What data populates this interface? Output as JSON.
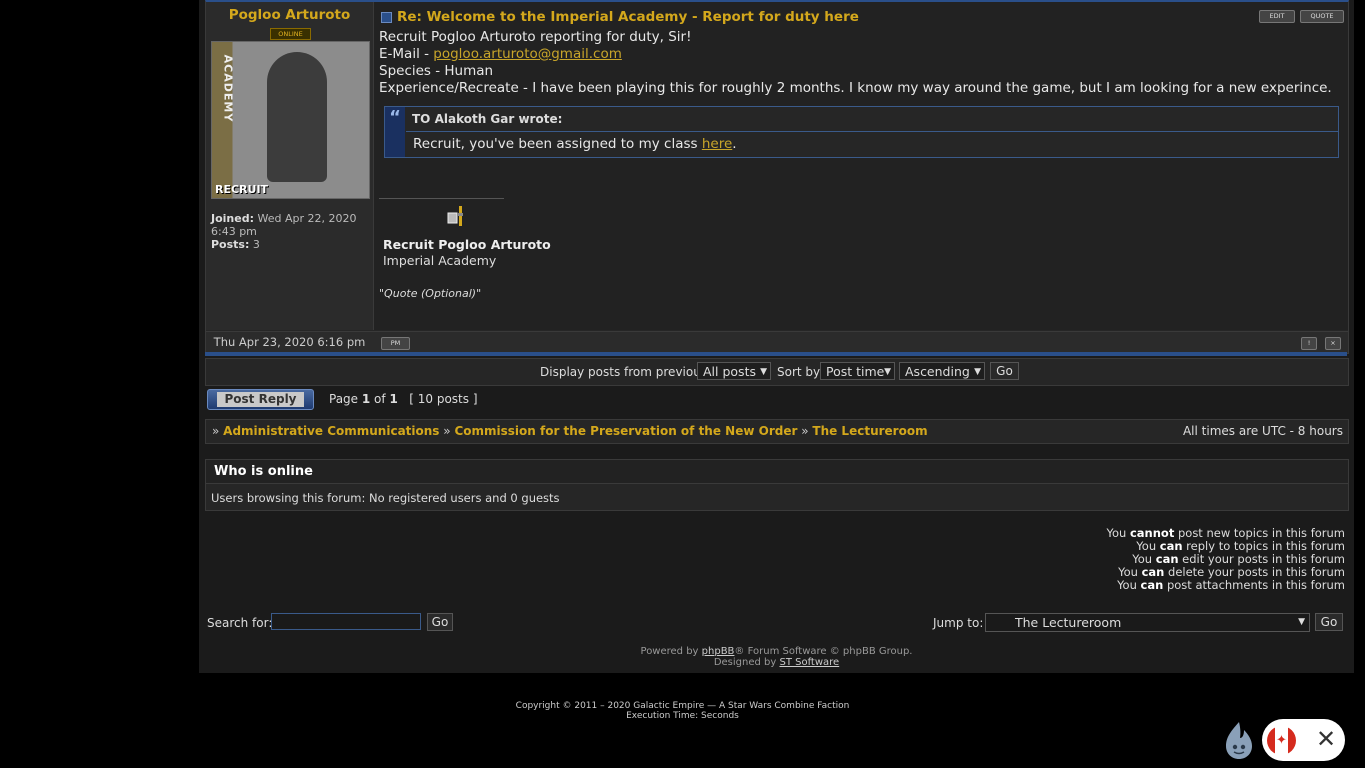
{
  "post": {
    "author": "Pogloo Arturoto",
    "status_badge": "ONLINE",
    "avatar_text_recruit": "RECRUIT",
    "avatar_text_academy": "ACADEMY",
    "joined_label": "Joined:",
    "joined_value": "Wed Apr 22, 2020 6:43 pm",
    "posts_label": "Posts:",
    "posts_value": "3",
    "subject": "Re: Welcome to the Imperial Academy - Report for duty here",
    "edit_label": "EDIT",
    "quote_label": "QUOTE",
    "lines": [
      "Recruit Pogloo Arturoto reporting for duty, Sir!",
      "E-Mail - ",
      "Species - Human",
      "Experience/Recreate - I have been playing this for roughly 2 months. I know my way around the game, but I am looking for a new experince."
    ],
    "email_link": "pogloo.arturoto@gmail.com",
    "quote": {
      "header": "TO Alakoth Gar wrote:",
      "text_before": "Recruit, you've been assigned to my class ",
      "link": "here",
      "text_after": "."
    },
    "signature": {
      "name": "Recruit Pogloo Arturoto",
      "org": "Imperial Academy",
      "quote": "\"Quote (Optional)\""
    },
    "date": "Thu Apr 23, 2020 6:16 pm",
    "pm_label": "PM"
  },
  "sortbar": {
    "display_label": "Display posts from previous:",
    "display_value": "All posts",
    "sort_label": "Sort by",
    "sort_value": "Post time",
    "order_value": "Ascending",
    "go_label": "Go"
  },
  "pagination": {
    "post_reply_label": "Post Reply",
    "page_prefix": "Page ",
    "page_current": "1",
    "page_of": " of ",
    "page_total": "1",
    "posts_count": "[ 10 posts ]"
  },
  "breadcrumb": {
    "sep": "»",
    "items": [
      "Administrative Communications",
      "Commission for the Preservation of the New Order",
      "The Lectureroom"
    ],
    "timezone": "All times are UTC - 8 hours"
  },
  "who_online": {
    "title": "Who is online",
    "text": "Users browsing this forum: No registered users and 0 guests"
  },
  "permissions": [
    {
      "pre": "You ",
      "key": "cannot",
      "post": " post new topics in this forum"
    },
    {
      "pre": "You ",
      "key": "can",
      "post": " reply to topics in this forum"
    },
    {
      "pre": "You ",
      "key": "can",
      "post": " edit your posts in this forum"
    },
    {
      "pre": "You ",
      "key": "can",
      "post": " delete your posts in this forum"
    },
    {
      "pre": "You ",
      "key": "can",
      "post": " post attachments in this forum"
    }
  ],
  "search": {
    "label": "Search for:",
    "placeholder": "",
    "go_label": "Go"
  },
  "jump": {
    "label": "Jump to:",
    "value": "The Lectureroom",
    "go_label": "Go"
  },
  "footer": {
    "powered_pre": "Powered by ",
    "phpbb": "phpBB",
    "powered_post": "® Forum Software © phpBB Group.",
    "designed_pre": "Designed by ",
    "designer": "ST Software",
    "copyright": "Copyright © 2011 – 2020 Galactic Empire — A Star Wars Combine Faction",
    "execution": "Execution Time: Seconds"
  },
  "colors": {
    "accent_gold": "#d4a81c",
    "accent_blue": "#2a4f8a",
    "canada_red": "#d52b1e"
  },
  "icons": [
    "post-icon",
    "edit-button",
    "quote-button",
    "pm-button",
    "report-icon",
    "warn-icon",
    "quote-mark-icon",
    "lightsaber-icon",
    "hotjar-icon",
    "canada-flag-icon",
    "close-icon"
  ]
}
